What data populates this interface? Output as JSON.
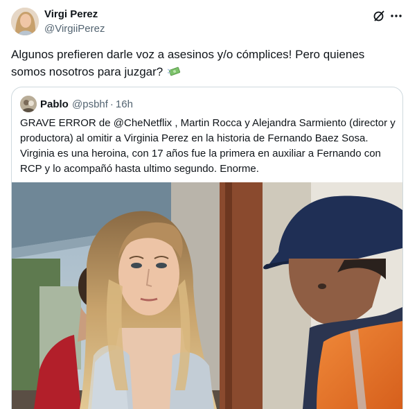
{
  "tweet": {
    "author_name": "Virgi Perez",
    "author_handle": "@VirgiiPerez",
    "text": "Algunos prefieren darle voz a asesinos y/o cómplices! Pero quienes somos nosotros para juzgar?",
    "emoji_icon": "money-with-wings-icon"
  },
  "quote": {
    "author_name": "Pablo",
    "author_handle": "@psbhf",
    "separator": "·",
    "time": "16h",
    "text": "GRAVE ERROR de @CheNetflix , Martin Rocca y Alejandra Sarmiento (director y productora) al omitir a Virginia Perez en la historia de Fernando Baez Sosa. Virginia es una heroina, con 17 años fue la primera en auxiliar a Fernando con RCP y lo acompañó hasta ultimo segundo. Enorme."
  },
  "colors": {
    "text": "#0f1419",
    "muted": "#536471",
    "border": "#cfd9de",
    "vest_orange": "#e8702a",
    "cap_navy": "#1f2f55"
  }
}
